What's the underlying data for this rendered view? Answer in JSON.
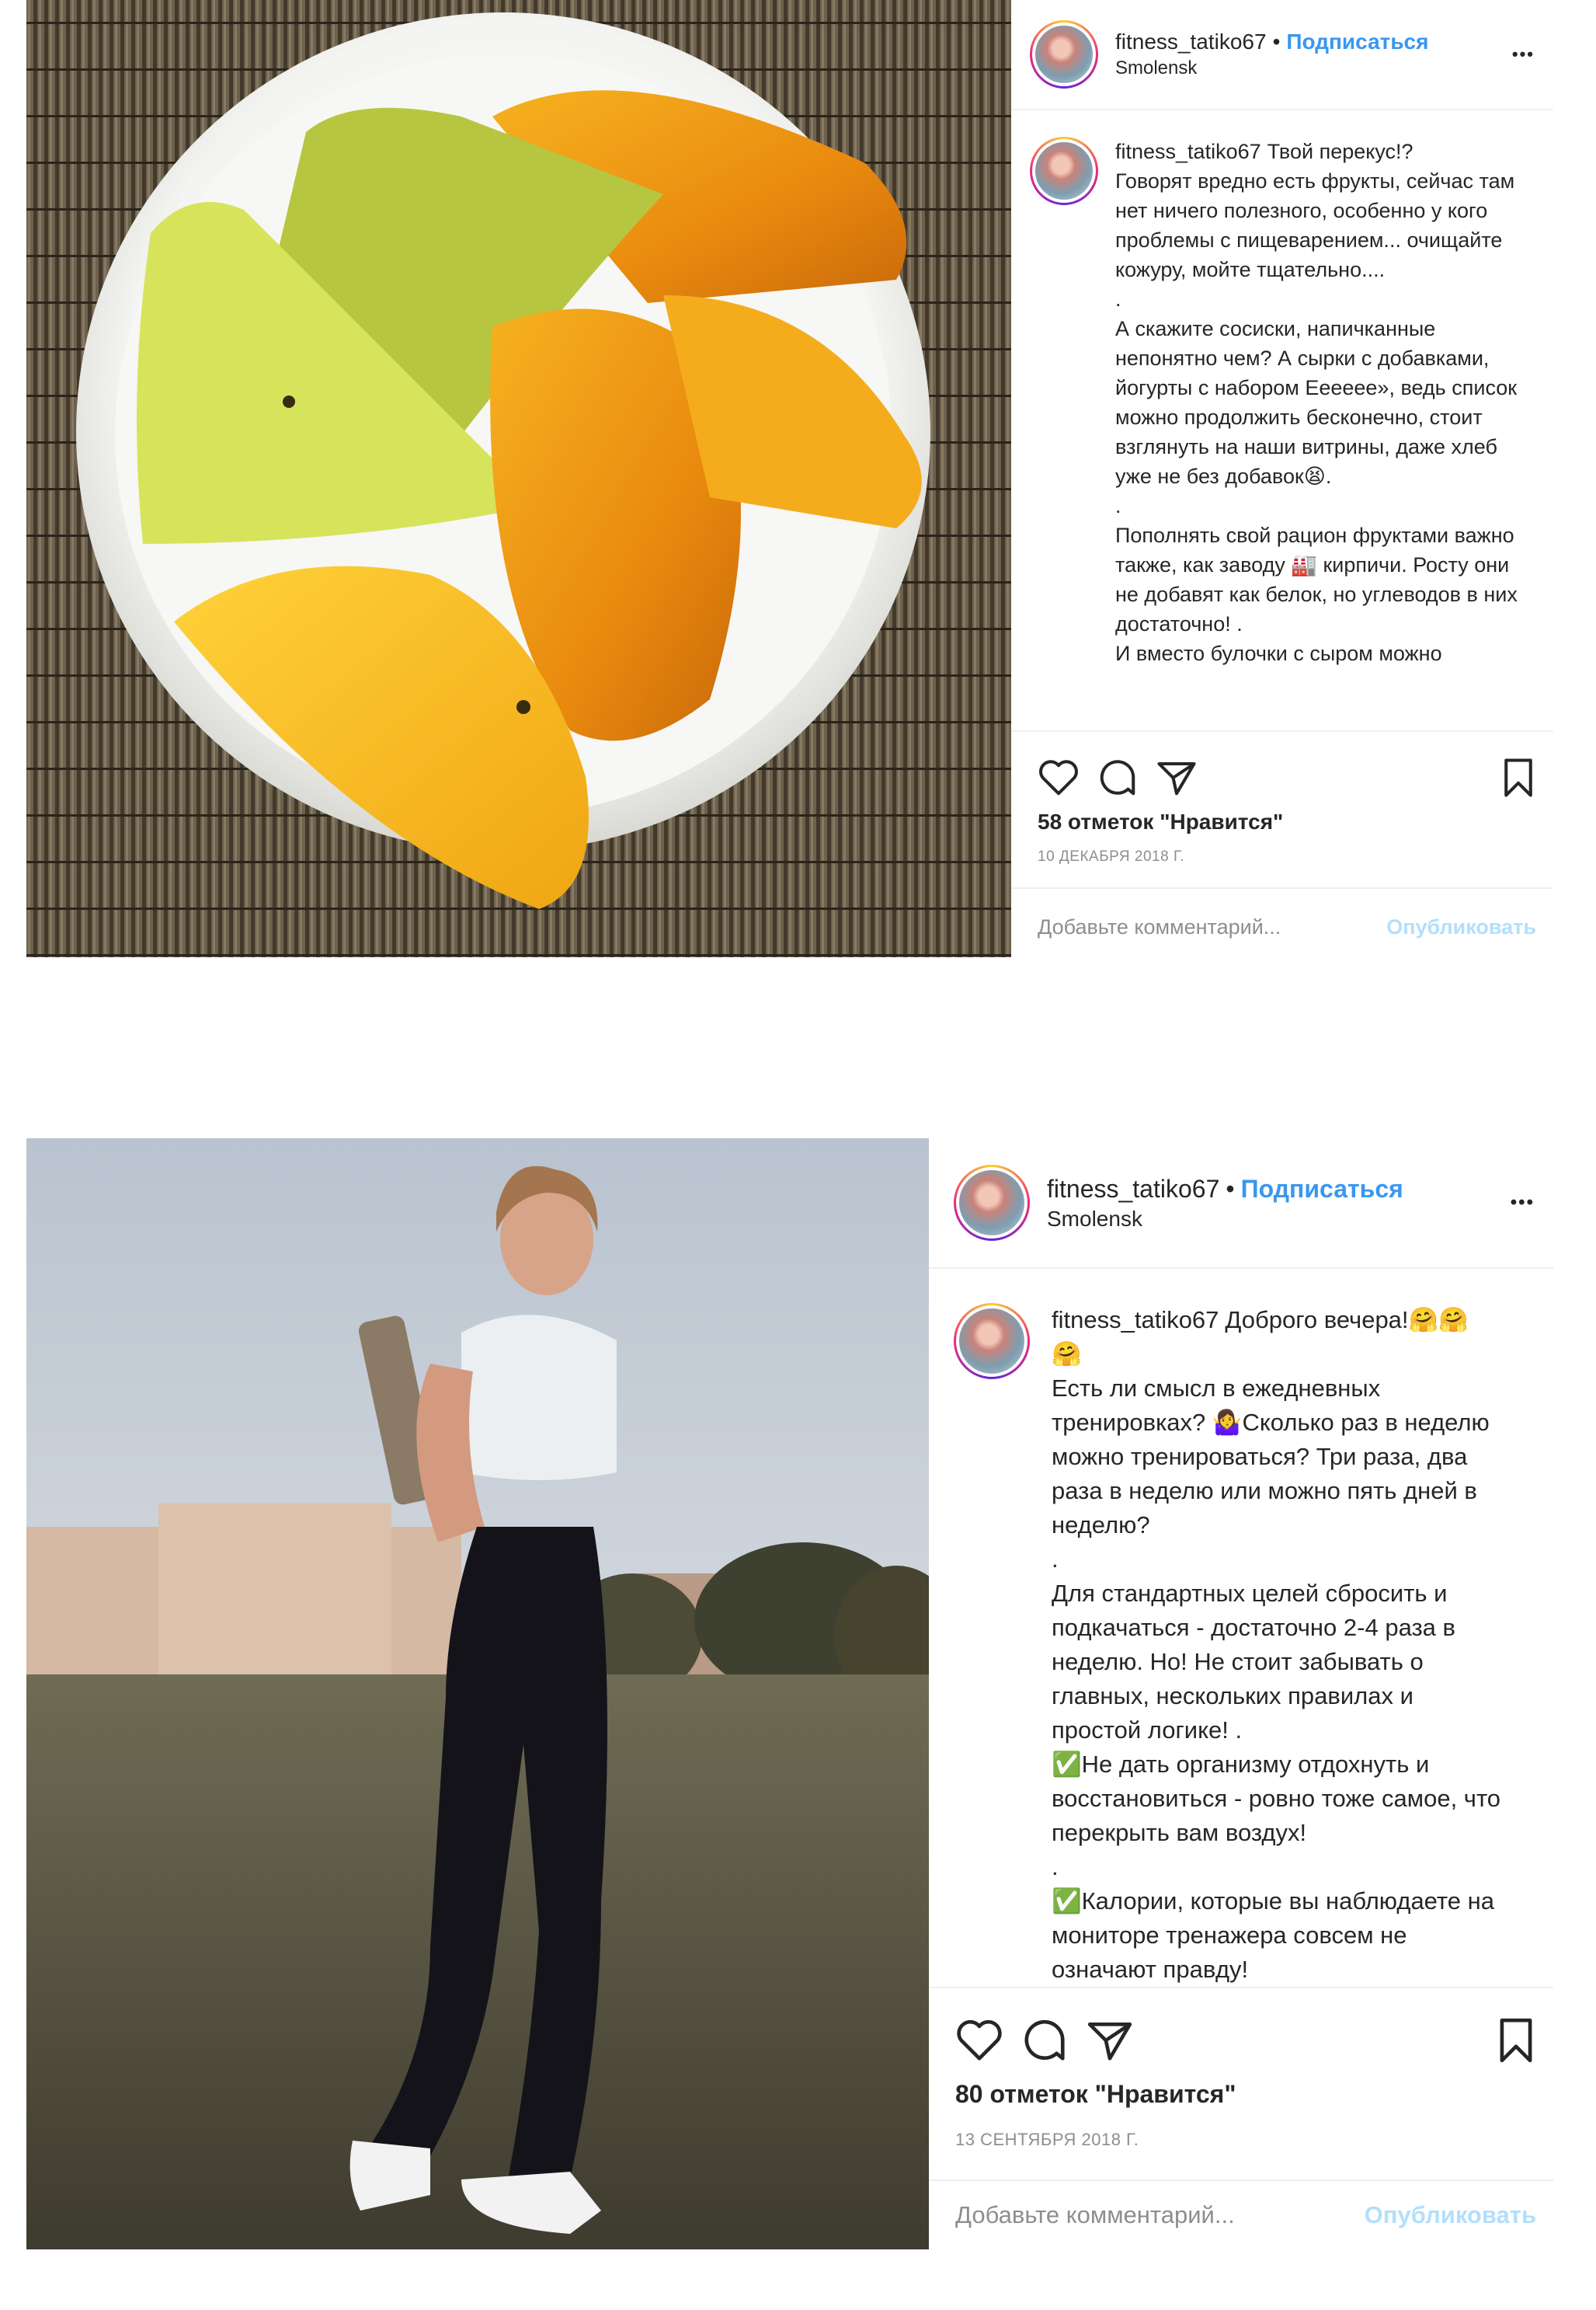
{
  "posts": [
    {
      "username": "fitness_tatiko67",
      "follow_label": "Подписаться",
      "location": "Smolensk",
      "more_label": "•••",
      "caption_username": "fitness_tatiko67",
      "caption": "Твой перекус!?\nГоворят вредно есть фрукты, сейчас там нет ничего полезного, особенно у кого проблемы с пищеварением... очищайте кожуру, мойте тщательно....\n.\nА скажите сосиски, напичканные непонятно чем? А сырки с добавками, йогурты с набором Ееееее», ведь список можно продолжить бесконечно, стоит взглянуть на наши витрины, даже хлеб уже не без добавок😫.\n.\nПополнять свой рацион фруктами важно также, как заводу 🏭 кирпичи. Росту они не добавят как белок, но углеводов в них достаточно! .\nИ вместо булочки с сыром можно",
      "likes": "58 отметок \"Нравится\"",
      "date": "10 ДЕКАБРЯ 2018 Г.",
      "comment_placeholder": "Добавьте комментарий...",
      "publish_label": "Опубликовать"
    },
    {
      "username": "fitness_tatiko67",
      "follow_label": "Подписаться",
      "location": "Smolensk",
      "more_label": "•••",
      "caption_username": "fitness_tatiko67",
      "caption": "Доброго вечера!🤗🤗\n🤗\nЕсть ли смысл в ежедневных тренировках? 🤷‍♀️Сколько раз в неделю можно тренироваться? Три раза, два раза в неделю или можно пять дней в неделю?\n.\nДля стандартных целей сбросить и подкачаться - достаточно 2-4 раза в неделю. Но! Не стоит забывать о главных, нескольких правилах и простой логике! .\n✅Не дать организму отдохнуть и восстановиться - ровно тоже самое, что перекрыть вам воздух!\n.\n✅Калории, которые вы наблюдаете на мониторе тренажера совсем не означают правду!",
      "likes": "80 отметок \"Нравится\"",
      "date": "13 СЕНТЯБРЯ 2018 Г.",
      "comment_placeholder": "Добавьте комментарий...",
      "publish_label": "Опубликовать"
    }
  ],
  "icons": {
    "like": "heart-icon",
    "comment": "comment-icon",
    "share": "share-icon",
    "save": "bookmark-icon",
    "more": "more-options-icon"
  },
  "colors": {
    "follow": "#3897f0",
    "publish_disabled": "#b2dffc",
    "meta_gray": "#8e8e8e",
    "divider": "#efefef"
  }
}
